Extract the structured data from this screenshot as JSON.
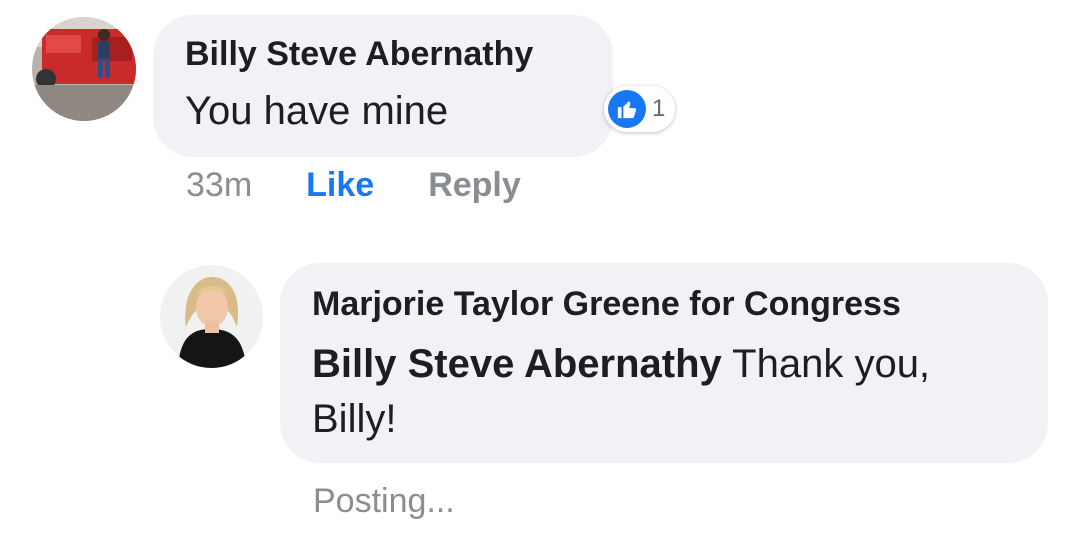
{
  "comment": {
    "author": "Billy Steve Abernathy",
    "text": "You have mine",
    "timestamp": "33m",
    "like_label": "Like",
    "reply_label": "Reply",
    "reaction_icon": "thumbs-up-icon",
    "reaction_count": "1"
  },
  "reply": {
    "author": "Marjorie Taylor Greene for Congress",
    "mention": "Billy Steve Abernathy",
    "text": " Thank you, Billy!",
    "status": "Posting..."
  },
  "colors": {
    "bubble": "#f0f2f5",
    "link_blue": "#1877f2",
    "meta_gray": "#8a8d91",
    "text": "#1c1e21"
  }
}
